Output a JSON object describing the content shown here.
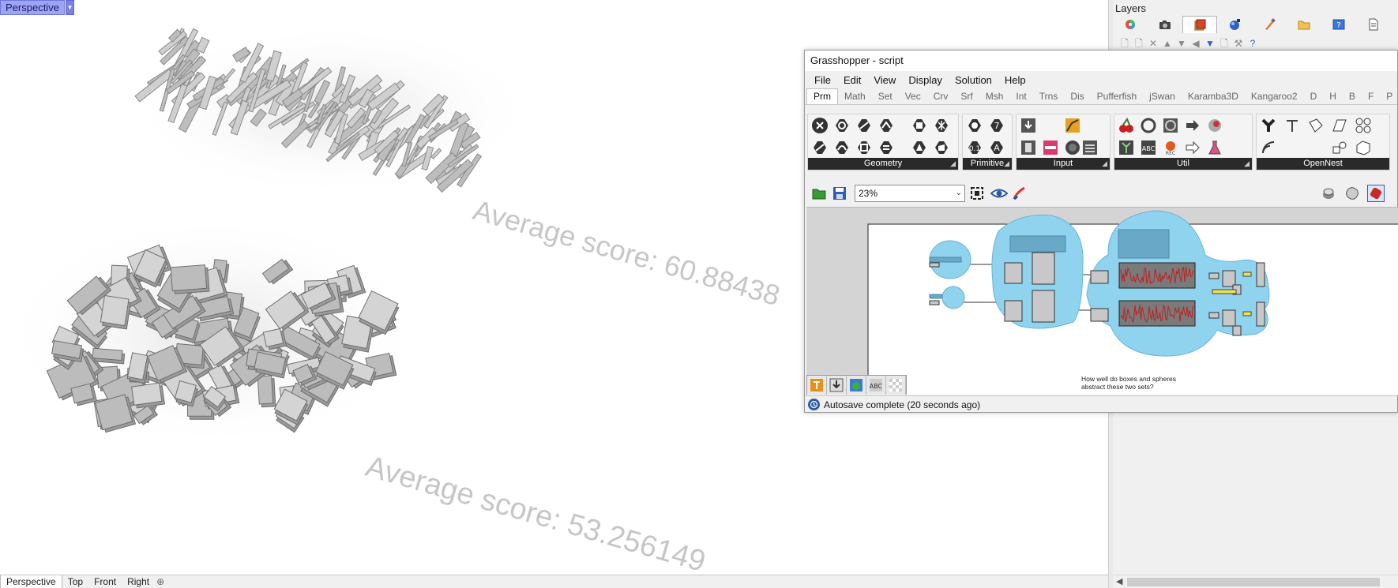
{
  "viewport": {
    "name": "Perspective",
    "score_top": "Average score: 60.88438",
    "score_bottom": "Average score: 53.256149",
    "tabs": [
      "Perspective",
      "Top",
      "Front",
      "Right"
    ]
  },
  "layers": {
    "title": "Layers",
    "icon_names": [
      "color-wheel-icon",
      "camera-icon",
      "layers-icon",
      "material-icon",
      "paint-brush-icon",
      "folder-icon",
      "help-icon",
      "document-icon"
    ]
  },
  "grasshopper": {
    "title": "Grasshopper - script",
    "menu": [
      "File",
      "Edit",
      "View",
      "Display",
      "Solution",
      "Help"
    ],
    "tabs": [
      "Prm",
      "Math",
      "Set",
      "Vec",
      "Crv",
      "Srf",
      "Msh",
      "Int",
      "Trns",
      "Dis",
      "Pufferfish",
      "jSwan",
      "Karamba3D",
      "Kangaroo2",
      "D",
      "H",
      "B",
      "F",
      "P"
    ],
    "active_tab": "Prm",
    "ribbon_groups": [
      {
        "label": "Geometry"
      },
      {
        "label": "Primitive"
      },
      {
        "label": "Input"
      },
      {
        "label": "Util"
      },
      {
        "label": "OpenNest"
      }
    ],
    "zoom": "23%",
    "canvas_note_line1": "How well do boxes and spheres",
    "canvas_note_line2": "abstract these two sets?",
    "status": "Autosave complete (20 seconds ago)"
  },
  "colors": {
    "viewport_title_bg": "#9ea4f0",
    "group_blue": "#8fd3ef",
    "ribbon_label_bg": "#2a2a2a",
    "score_text": "#c6c6c6"
  }
}
